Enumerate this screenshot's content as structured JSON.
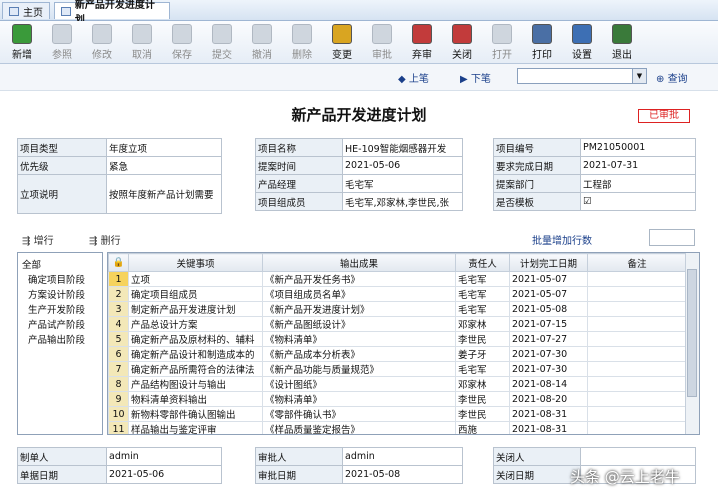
{
  "tabs": [
    {
      "label": "主页"
    },
    {
      "label": "新产品开发进度计划"
    }
  ],
  "toolbar": [
    {
      "label": "新增",
      "icon": "add-icon",
      "enabled": true
    },
    {
      "label": "参照",
      "icon": "reference-icon",
      "enabled": false
    },
    {
      "label": "修改",
      "icon": "edit-icon",
      "enabled": false
    },
    {
      "label": "取消",
      "icon": "cancel-icon",
      "enabled": false
    },
    {
      "label": "保存",
      "icon": "save-icon",
      "enabled": false
    },
    {
      "label": "提交",
      "icon": "submit-icon",
      "enabled": false
    },
    {
      "label": "撤消",
      "icon": "undo-icon",
      "enabled": false
    },
    {
      "label": "删除",
      "icon": "delete-icon",
      "enabled": false
    },
    {
      "label": "变更",
      "icon": "change-icon",
      "enabled": true
    },
    {
      "label": "审批",
      "icon": "approve-icon",
      "enabled": false
    },
    {
      "label": "弃审",
      "icon": "unapprove-icon",
      "enabled": true
    },
    {
      "label": "关闭",
      "icon": "close-icon",
      "enabled": true
    },
    {
      "label": "打开",
      "icon": "open-icon",
      "enabled": false
    },
    {
      "label": "打印",
      "icon": "print-icon",
      "enabled": true
    },
    {
      "label": "设置",
      "icon": "settings-icon",
      "enabled": true
    },
    {
      "label": "退出",
      "icon": "exit-icon",
      "enabled": true
    }
  ],
  "nav": {
    "prev": "上笔",
    "next": "下笔",
    "search_value": "",
    "query": "查询"
  },
  "title": "新产品开发进度计划",
  "status": "已审批",
  "form_left": [
    {
      "label": "项目类型",
      "value": "年度立项"
    },
    {
      "label": "优先级",
      "value": "紧急"
    },
    {
      "label": "立项说明",
      "value": "按照年度新产品计划需要"
    }
  ],
  "form_mid": [
    {
      "label": "项目名称",
      "value": "HE-109智能烟感器开发"
    },
    {
      "label": "提案时间",
      "value": "2021-05-06"
    },
    {
      "label": "产品经理",
      "value": "毛宅军"
    },
    {
      "label": "项目组成员",
      "value": "毛宅军,邓家林,李世民,张"
    }
  ],
  "form_right": [
    {
      "label": "项目编号",
      "value": "PM21050001"
    },
    {
      "label": "要求完成日期",
      "value": "2021-07-31"
    },
    {
      "label": "提案部门",
      "value": "工程部"
    },
    {
      "label": "是否模板",
      "value": "☑"
    }
  ],
  "row_actions": {
    "add": "增行",
    "delete": "删行",
    "batch": "批量增加行数"
  },
  "tree": [
    "全部",
    "确定项目阶段",
    "方案设计阶段",
    "生产开发阶段",
    "产品试产阶段",
    "产品输出阶段"
  ],
  "grid": {
    "headers": [
      "关键事项",
      "输出成果",
      "责任人",
      "计划完工日期",
      "备注"
    ],
    "rows": [
      [
        "1",
        "立项",
        "《新产品开发任务书》",
        "毛宅军",
        "2021-05-07",
        ""
      ],
      [
        "2",
        "确定项目组成员",
        "《项目组成员名单》",
        "毛宅军",
        "2021-05-07",
        ""
      ],
      [
        "3",
        "制定新产品开发进度计划",
        "《新产品开发进度计划》",
        "毛宅军",
        "2021-05-08",
        ""
      ],
      [
        "4",
        "产品总设计方案",
        "《新产品图纸设计》",
        "邓家林",
        "2021-07-15",
        ""
      ],
      [
        "5",
        "确定新产品及原材料的、辅料",
        "《物料清单》",
        "李世民",
        "2021-07-27",
        ""
      ],
      [
        "6",
        "确定新产品设计和制造成本的",
        "《新产品成本分析表》",
        "姜子牙",
        "2021-07-30",
        ""
      ],
      [
        "7",
        "确定新产品所需符合的法律法",
        "《新产品功能与质量规范》",
        "毛宅军",
        "2021-07-30",
        ""
      ],
      [
        "8",
        "产品结构图设计与输出",
        "《设计图纸》",
        "邓家林",
        "2021-08-14",
        ""
      ],
      [
        "9",
        "物料清单资料输出",
        "《物料清单》",
        "李世民",
        "2021-08-20",
        ""
      ],
      [
        "10",
        "新物料零部件确认图输出",
        "《零部件确认书》",
        "李世民",
        "2021-08-31",
        ""
      ],
      [
        "11",
        "样品输出与鉴定评审",
        "《样品质量鉴定报告》",
        "西施",
        "2021-08-31",
        ""
      ]
    ]
  },
  "footer_left": [
    {
      "label": "制单人",
      "value": "admin"
    },
    {
      "label": "单据日期",
      "value": "2021-05-06"
    }
  ],
  "footer_mid": [
    {
      "label": "审批人",
      "value": "admin"
    },
    {
      "label": "审批日期",
      "value": "2021-05-08"
    }
  ],
  "footer_right": [
    {
      "label": "关闭人",
      "value": ""
    },
    {
      "label": "关闭日期",
      "value": ""
    }
  ],
  "watermark": "头条 @云上老牛"
}
